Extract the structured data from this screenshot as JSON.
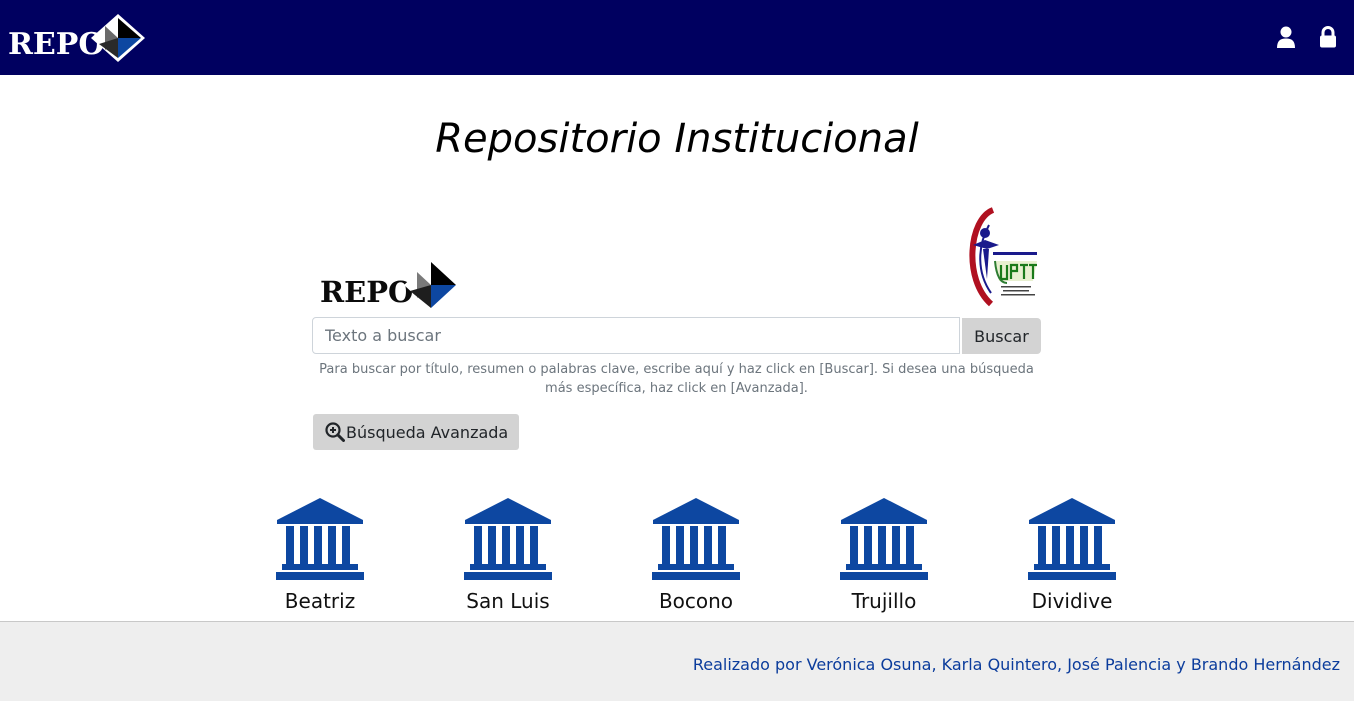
{
  "header": {
    "brand_text": "REPO",
    "icons": [
      "user-icon",
      "lock-icon"
    ]
  },
  "main": {
    "title": "Repositorio Institucional",
    "logo_text": "REPO",
    "search": {
      "placeholder": "Texto a buscar",
      "value": "",
      "button_label": "Buscar",
      "help_text": "Para buscar por título, resumen o palabras clave, escribe aquí y haz click en [Buscar]. Si desea una búsqueda más específica, haz click en [Avanzada]."
    },
    "advanced_button_label": "Búsqueda Avanzada",
    "campuses": [
      {
        "label": "Beatriz",
        "icon": "institution-icon"
      },
      {
        "label": "San Luis",
        "icon": "institution-icon"
      },
      {
        "label": "Bocono",
        "icon": "institution-icon"
      },
      {
        "label": "Trujillo",
        "icon": "institution-icon"
      },
      {
        "label": "Dividive",
        "icon": "institution-icon"
      }
    ]
  },
  "footer": {
    "credits": "Realizado por Verónica Osuna, Karla Quintero, José Palencia y Brando Hernández"
  },
  "colors": {
    "header_bg": "#000060",
    "institution_icon": "#0d47a1",
    "button_bg": "#d3d3d3",
    "footer_bg": "#eeeeee",
    "footer_link": "#0b3c9c"
  }
}
